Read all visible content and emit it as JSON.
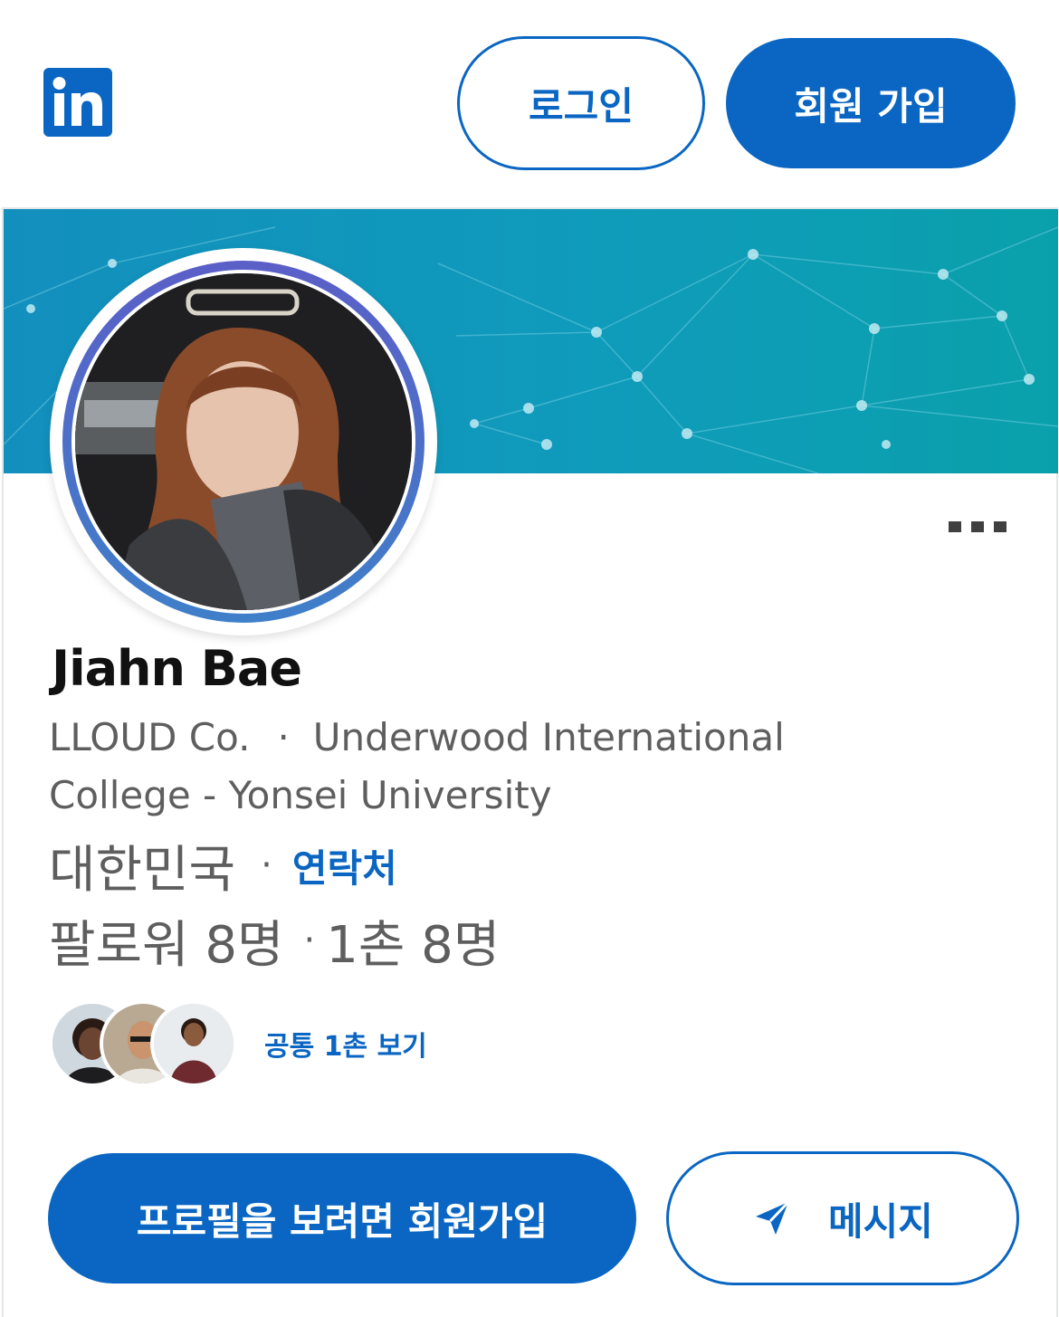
{
  "header": {
    "logo_icon": "linkedin-logo-icon",
    "logo_text": "in",
    "login_label": "로그인",
    "join_label": "회원 가입"
  },
  "profile": {
    "name": "Jiahn Bae",
    "headline_company": "LLOUD Co.",
    "headline_separator": "·",
    "headline_school": "Underwood International College - Yonsei University",
    "location": "대한민국",
    "location_separator": "·",
    "contact_label": "연락처",
    "followers_label": "팔로워 8명",
    "followers_separator": "·",
    "connections_label": "1촌 8명",
    "mutual_link": "공통 1촌 보기"
  },
  "actions": {
    "signup_to_view_label": "프로필을 보려면 회원가입",
    "message_label": "메시지",
    "message_icon": "send-icon",
    "more_icon": "more-options-icon"
  },
  "colors": {
    "brand": "#0a66c2",
    "text_secondary": "#5e5e5e",
    "banner_start": "#138fbd",
    "banner_end": "#0aa0ab"
  }
}
